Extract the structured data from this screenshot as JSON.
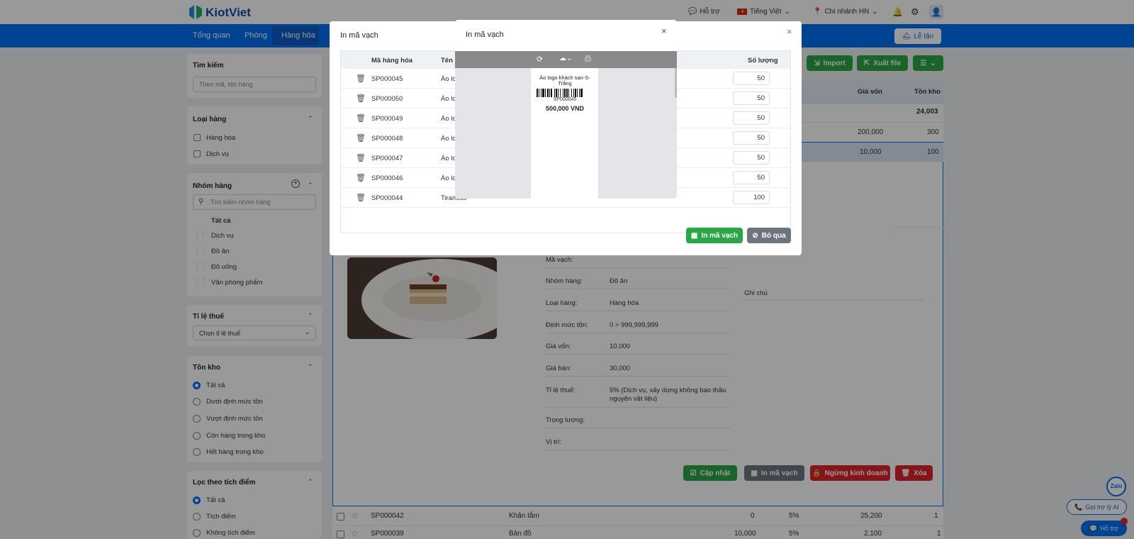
{
  "header": {
    "logo_text": "KiotViet",
    "support": "Hỗ trợ",
    "language": "Tiếng Việt",
    "branch": "Chi nhánh HN"
  },
  "nav": {
    "items": [
      "Tổng quan",
      "Phòng",
      "Hàng hóa"
    ],
    "le_tan": "Lễ tân"
  },
  "sidebar": {
    "search_title": "Tìm kiếm",
    "search_placeholder": "Theo mã, tên hàng",
    "type_title": "Loại hàng",
    "types": [
      "Hàng hóa",
      "Dịch vụ"
    ],
    "group_title": "Nhóm hàng",
    "group_placeholder": "Tìm kiếm nhóm hàng",
    "groups": [
      "Tất cả",
      "Dịch vụ",
      "Đồ ăn",
      "Đồ uống",
      "Văn phòng phẩm"
    ],
    "tax_title": "Tỉ lệ thuế",
    "tax_select": "Chọn tỉ lệ thuế",
    "stock_title": "Tồn kho",
    "stock_options": [
      "Tất cả",
      "Dưới định mức tồn",
      "Vượt định mức tồn",
      "Còn hàng trong kho",
      "Hết hàng trong kho"
    ],
    "points_title": "Lọc theo tích điểm",
    "points_options": [
      "Tất cả",
      "Tích điểm",
      "Không tích điểm"
    ]
  },
  "toolbar": {
    "import": "Import",
    "export": "Xuất file"
  },
  "table": {
    "headers": [
      "Giá vốn",
      "Tồn kho"
    ],
    "total_stock": "24,003",
    "row1": {
      "cost": "200,000",
      "stock": "300"
    },
    "row2": {
      "cost": "10,000",
      "stock": "100"
    },
    "bottom_rows": [
      {
        "code": "SP000042",
        "name": "Khăn tắm",
        "price": "0",
        "tax": "5%",
        "cost": "25,200",
        "stock": "1"
      },
      {
        "code": "SP000039",
        "name": "Bản đồ",
        "price": "10,000",
        "tax": "5%",
        "cost": "2,100",
        "stock": "1"
      }
    ]
  },
  "detail": {
    "fields": [
      {
        "label": "Mã vạch:",
        "value": ""
      },
      {
        "label": "Nhóm hàng:",
        "value": "Đồ ăn"
      },
      {
        "label": "Loại hàng:",
        "value": "Hàng hóa"
      },
      {
        "label": "Định mức tồn:",
        "value": "0  >  999,999,999"
      },
      {
        "label": "Giá vốn:",
        "value": "10,000"
      },
      {
        "label": "Giá bán:",
        "value": "30,000"
      },
      {
        "label": "Tỉ lệ thuế:",
        "value": "5% (Dịch vụ, xây dựng không bao thầu nguyên vật liệu)"
      },
      {
        "label": "Trọng lượng:",
        "value": ""
      },
      {
        "label": "Vị trí:",
        "value": ""
      }
    ],
    "note_label": "Ghi chú",
    "buttons": {
      "update": "Cập nhật",
      "print": "In mã vạch",
      "stop": "Ngừng kinh doanh",
      "delete": "Xóa"
    }
  },
  "dialog": {
    "title": "In mã vạch",
    "col_code": "Mã hàng hóa",
    "col_name": "Tên h",
    "col_qty": "Số lượng",
    "rows": [
      {
        "code": "SP000045",
        "name": "Áo lo",
        "qty": "50"
      },
      {
        "code": "SP000050",
        "name": "Áo lo",
        "qty": "50"
      },
      {
        "code": "SP000049",
        "name": "Áo lo",
        "qty": "50"
      },
      {
        "code": "SP000048",
        "name": "Áo lo",
        "qty": "50"
      },
      {
        "code": "SP000047",
        "name": "Áo lo",
        "qty": "50"
      },
      {
        "code": "SP000046",
        "name": "Áo lo",
        "qty": "50"
      },
      {
        "code": "SP000044",
        "name": "Tiramisu",
        "qty": "100"
      }
    ],
    "print_btn": "In mã vạch",
    "skip_btn": "Bỏ qua"
  },
  "preview": {
    "title": "In mã vạch",
    "label_name": "Áo logo khách sạn-S-Trắng",
    "label_code": "SP000045",
    "label_price": "500,000 VND"
  },
  "floating": {
    "zalo": "Zalo",
    "ai": "Gọi trợ lý AI",
    "support": "Hỗ trợ"
  }
}
